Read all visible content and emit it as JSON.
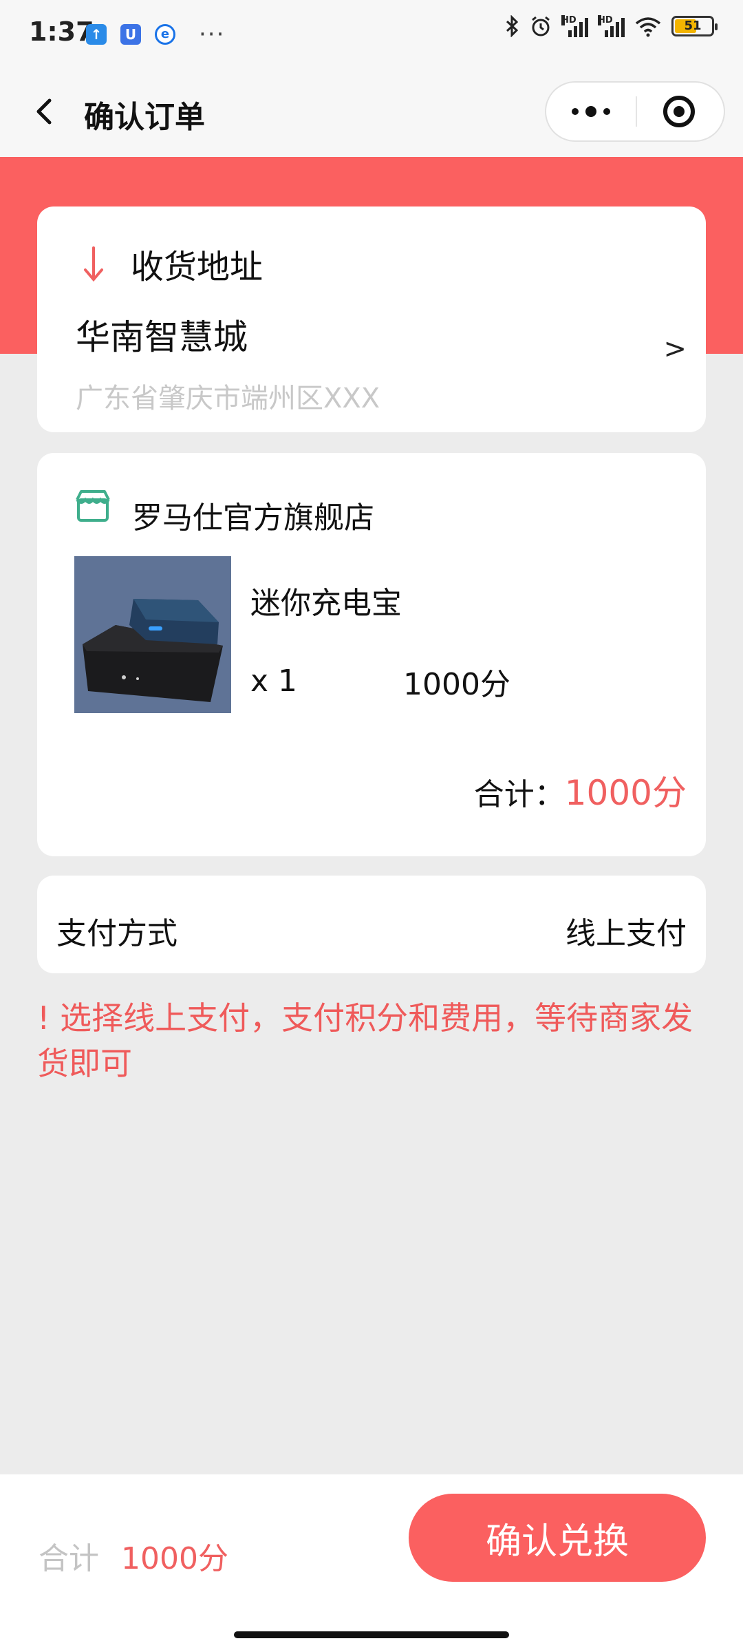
{
  "status_bar": {
    "time": "1:37",
    "app_icons": [
      "upload-icon",
      "u-app-icon",
      "edge-browser-icon"
    ],
    "more": "···",
    "battery_level": "51",
    "hd_label": "HD"
  },
  "nav": {
    "title": "确认订单"
  },
  "address": {
    "header": "收货地址",
    "name": "华南智慧城",
    "detail": "广东省肇庆市端州区XXX",
    "chevron": ">"
  },
  "store": {
    "name": "罗马仕官方旗舰店",
    "product": {
      "name": "迷你充电宝",
      "quantity": "x 1",
      "price": "1000分"
    },
    "total_label": "合计：",
    "total_value": "1000分"
  },
  "payment": {
    "label": "支付方式",
    "value": "线上支付"
  },
  "notice": "! 选择线上支付，支付积分和费用，等待商家发货即可",
  "bottom_bar": {
    "total_label": "合计",
    "total_value": "1000分",
    "confirm_label": "确认兑换"
  },
  "colors": {
    "accent": "#fb6060",
    "price_red": "#f06060",
    "store_icon_green": "#3fae8c"
  }
}
